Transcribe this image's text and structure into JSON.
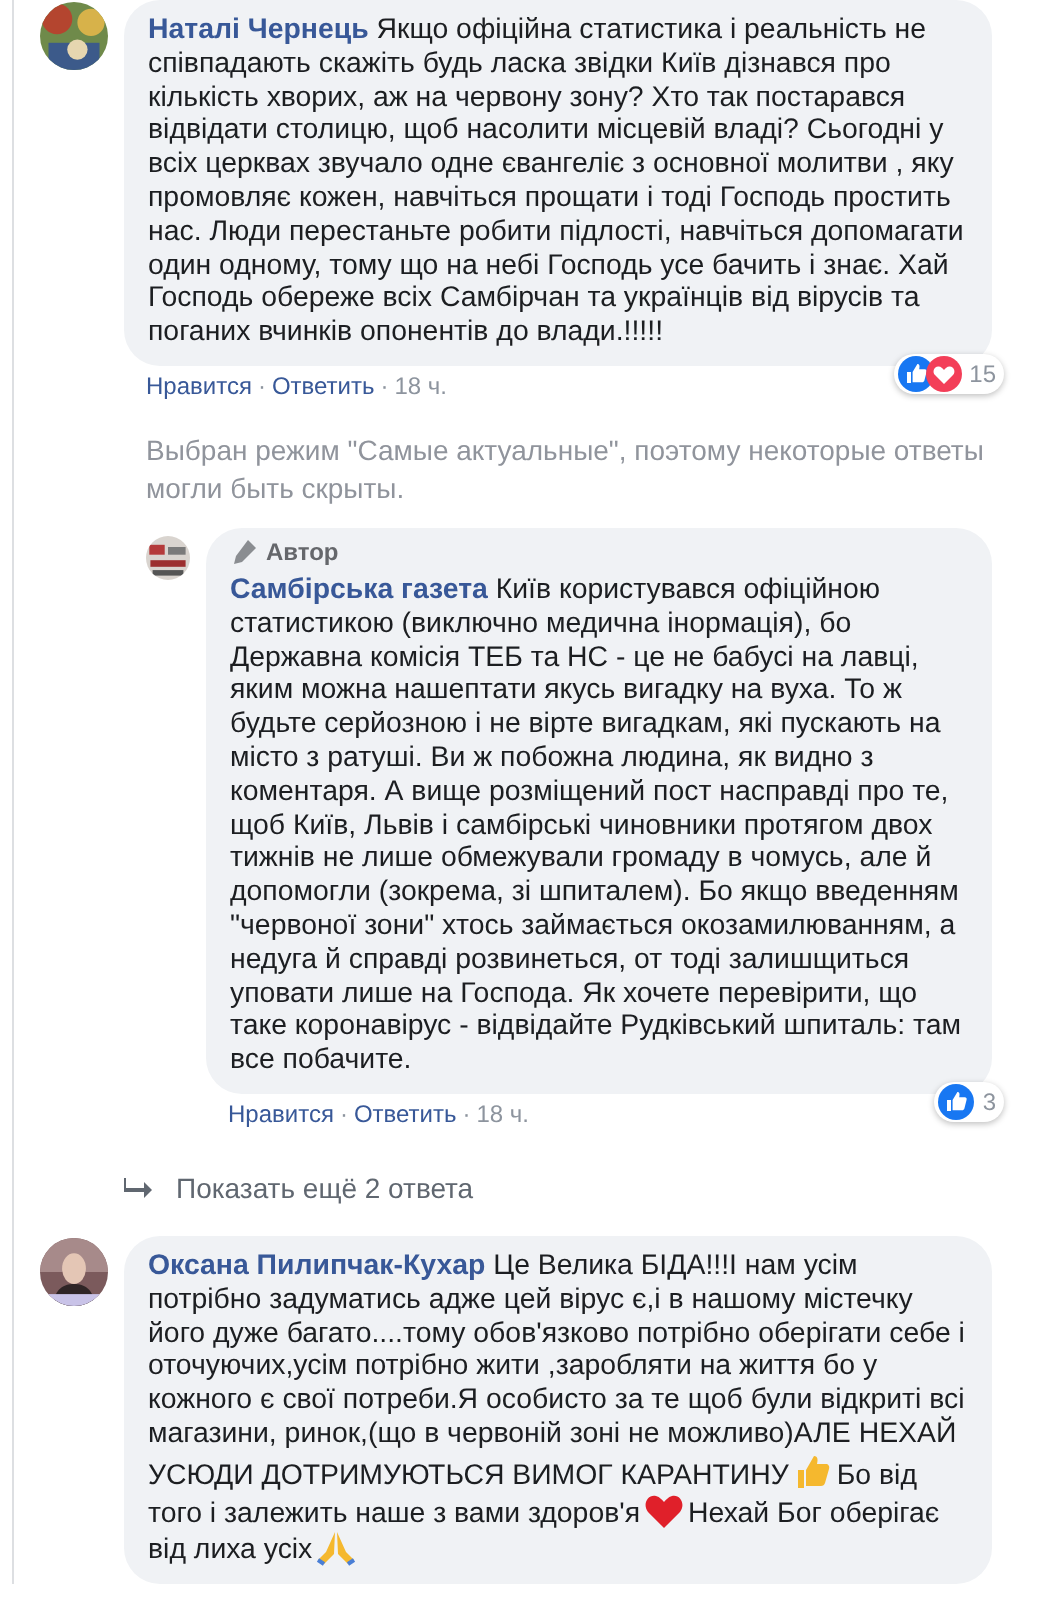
{
  "separator": "·",
  "comments": [
    {
      "author": "Наталі Чернець",
      "segments": [
        "Якщо офіційна статистика і реальність не співпадають скажіть будь ласка звідки Київ дізнався про кількість хворих, аж на червону зону? Хто так постарався відвідати столицю, щоб насолити місцевій владі? Сьогодні у всіх церквах звучало одне євангеліє з основної молитви , яку промовляє кожен, навчіться прощати і тоді Господь простить нас. Люди перестаньте робити підлості, навчіться допомагати один одному, тому що на небі Господь усе бачить і знає. Хай Господь обереже всіх Самбірчан та українців від вірусів та поганих вчинків опонентів до влади.!!!!!"
      ],
      "like": "Нравится",
      "reply": "Ответить",
      "time": "18 ч.",
      "reaction_count": "15",
      "notice": "Выбран режим \"Самые актуальные\", поэтому некоторые ответы могли быть скрыты.",
      "replies": [
        {
          "badge": "Автор",
          "author": "Самбірська газета",
          "segments": [
            "Київ користувався офіційною статистикою (виключно медична інормація), бо Державна комісія ТЕБ та НС - це не бабусі на лавці, яким можна нашептати якусь вигадку на вуха. То ж будьте серйозною і не вірте вигадкам, які пускають на місто з ратуші. Ви ж побожна людина, як видно з коментаря. А вище розміщений пост насправді про те, щоб Київ, Львів і самбірські чиновники протягом двох тижнів не лише обмежували громаду в чомусь, але й допомогли (зокрема, зі шпиталем). Бо якщо введенням \"червоної зони\" хтось займається окозамилюванням, а недуга й справді розвинеться, от тоді залишщиться уповати лише на Господа. Як хочете перевірити, що таке коронавірус - відвідайте Рудківський шпиталь: там все побачите."
          ],
          "like": "Нравится",
          "reply": "Ответить",
          "time": "18 ч.",
          "reaction_count": "3"
        }
      ],
      "show_more": "Показать ещё 2 ответа"
    },
    {
      "author": "Оксана Пилипчак-Кухар",
      "segments": [
        "Це Велика БІДА!!!І нам усім потрібно задуматись адже цей вірус є,і в нашому містечку його дуже багато....тому обов'язково потрібно оберігати себе і оточуючих,усім потрібно жити ,заробляти на життя бо у кожного є свої потреби.Я особисто за те щоб були відкриті всі магазини, ринок,(що в червоній зоні не можливо)АЛЕ НЕХАЙ УСЮДИ ДОТРИМУЮТЬСЯ ВИМОГ КАРАНТИНУ",
        "Бо від того і залежить наше з вами здоров'я",
        "Нехай Бог оберігає від лиха усіх"
      ]
    }
  ]
}
